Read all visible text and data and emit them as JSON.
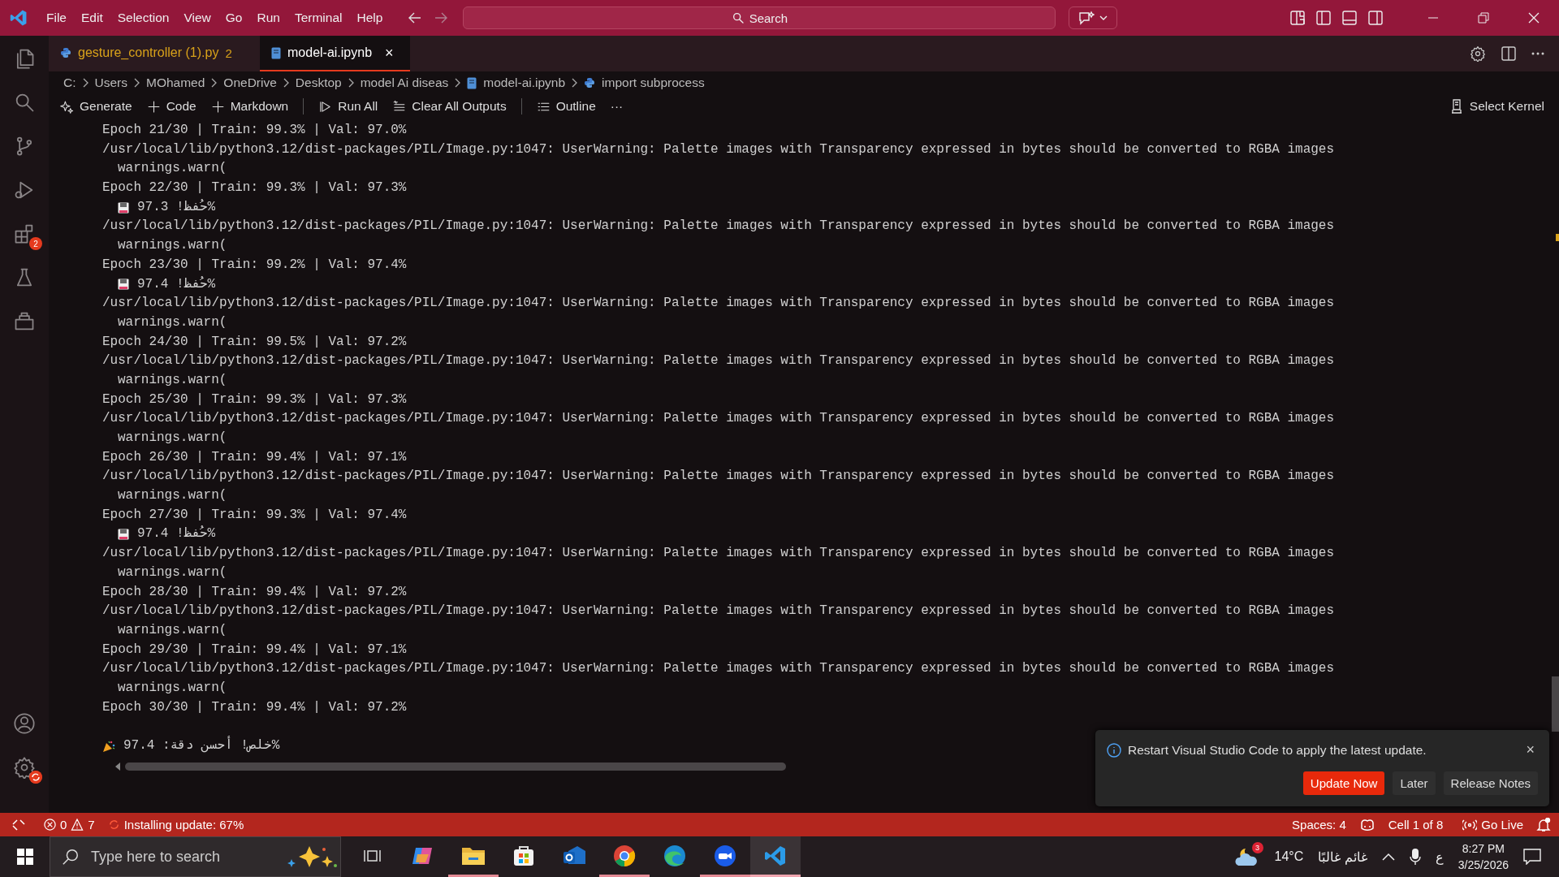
{
  "title_bar": {
    "menu": [
      "File",
      "Edit",
      "Selection",
      "View",
      "Go",
      "Run",
      "Terminal",
      "Help"
    ],
    "search": "Search"
  },
  "activity_bar": {
    "top": [
      {
        "kind": "files"
      },
      {
        "kind": "search"
      },
      {
        "kind": "source-control"
      },
      {
        "kind": "run-debug"
      },
      {
        "kind": "extensions",
        "badge": "2"
      },
      {
        "kind": "flask"
      },
      {
        "kind": "remote"
      }
    ],
    "bottom": [
      {
        "kind": "account"
      },
      {
        "kind": "settings"
      }
    ]
  },
  "tabs": [
    {
      "label": "gesture_controller (1).py",
      "badge": "2",
      "kind": "python",
      "selected": false
    },
    {
      "label": "model-ai.ipynb",
      "kind": "notebook",
      "selected": true,
      "close": "×"
    }
  ],
  "breadcrumb": [
    {
      "label": "C:"
    },
    {
      "label": "Users"
    },
    {
      "label": "MOhamed"
    },
    {
      "label": "OneDrive"
    },
    {
      "label": "Desktop"
    },
    {
      "label": "model Ai diseas"
    },
    {
      "label": "model-ai.ipynb",
      "kind": "notebook"
    },
    {
      "label": "import subprocess",
      "kind": "python"
    }
  ],
  "toolbar": {
    "groups": [
      [
        {
          "label": "Generate",
          "kind": "sparkle"
        },
        {
          "label": "Code",
          "kind": "plus"
        },
        {
          "label": "Markdown",
          "kind": "plus"
        }
      ],
      [
        {
          "label": "Run All",
          "kind": "run"
        },
        {
          "label": "Clear All Outputs",
          "kind": "clear"
        }
      ],
      [
        {
          "label": "Outline",
          "kind": "list"
        }
      ]
    ],
    "more": "···",
    "kernel": "Select Kernel"
  },
  "output": [
    {
      "kind": "text",
      "text": "Epoch 21/30 | Train: 99.3% | Val: 97.0%"
    },
    {
      "kind": "text",
      "text": "/usr/local/lib/python3.12/dist-packages/PIL/Image.py:1047: UserWarning: Palette images with Transparency expressed in bytes should be converted to RGBA images"
    },
    {
      "kind": "indent",
      "text": "warnings.warn("
    },
    {
      "kind": "text",
      "text": "Epoch 22/30 | Train: 99.3% | Val: 97.3%"
    },
    {
      "kind": "saved",
      "text": "حُفظ! 97.3%"
    },
    {
      "kind": "text",
      "text": "/usr/local/lib/python3.12/dist-packages/PIL/Image.py:1047: UserWarning: Palette images with Transparency expressed in bytes should be converted to RGBA images"
    },
    {
      "kind": "indent",
      "text": "warnings.warn("
    },
    {
      "kind": "text",
      "text": "Epoch 23/30 | Train: 99.2% | Val: 97.4%"
    },
    {
      "kind": "saved",
      "text": "حُفظ! 97.4%"
    },
    {
      "kind": "text",
      "text": "/usr/local/lib/python3.12/dist-packages/PIL/Image.py:1047: UserWarning: Palette images with Transparency expressed in bytes should be converted to RGBA images"
    },
    {
      "kind": "indent",
      "text": "warnings.warn("
    },
    {
      "kind": "text",
      "text": "Epoch 24/30 | Train: 99.5% | Val: 97.2%"
    },
    {
      "kind": "text",
      "text": "/usr/local/lib/python3.12/dist-packages/PIL/Image.py:1047: UserWarning: Palette images with Transparency expressed in bytes should be converted to RGBA images"
    },
    {
      "kind": "indent",
      "text": "warnings.warn("
    },
    {
      "kind": "text",
      "text": "Epoch 25/30 | Train: 99.3% | Val: 97.3%"
    },
    {
      "kind": "text",
      "text": "/usr/local/lib/python3.12/dist-packages/PIL/Image.py:1047: UserWarning: Palette images with Transparency expressed in bytes should be converted to RGBA images"
    },
    {
      "kind": "indent",
      "text": "warnings.warn("
    },
    {
      "kind": "text",
      "text": "Epoch 26/30 | Train: 99.4% | Val: 97.1%"
    },
    {
      "kind": "text",
      "text": "/usr/local/lib/python3.12/dist-packages/PIL/Image.py:1047: UserWarning: Palette images with Transparency expressed in bytes should be converted to RGBA images"
    },
    {
      "kind": "indent",
      "text": "warnings.warn("
    },
    {
      "kind": "text",
      "text": "Epoch 27/30 | Train: 99.3% | Val: 97.4%"
    },
    {
      "kind": "saved",
      "text": "حُفظ! 97.4%"
    },
    {
      "kind": "text",
      "text": "/usr/local/lib/python3.12/dist-packages/PIL/Image.py:1047: UserWarning: Palette images with Transparency expressed in bytes should be converted to RGBA images"
    },
    {
      "kind": "indent",
      "text": "warnings.warn("
    },
    {
      "kind": "text",
      "text": "Epoch 28/30 | Train: 99.4% | Val: 97.2%"
    },
    {
      "kind": "text",
      "text": "/usr/local/lib/python3.12/dist-packages/PIL/Image.py:1047: UserWarning: Palette images with Transparency expressed in bytes should be converted to RGBA images"
    },
    {
      "kind": "indent",
      "text": "warnings.warn("
    },
    {
      "kind": "text",
      "text": "Epoch 29/30 | Train: 99.4% | Val: 97.1%"
    },
    {
      "kind": "text",
      "text": "/usr/local/lib/python3.12/dist-packages/PIL/Image.py:1047: UserWarning: Palette images with Transparency expressed in bytes should be converted to RGBA images"
    },
    {
      "kind": "indent",
      "text": "warnings.warn("
    },
    {
      "kind": "text",
      "text": "Epoch 30/30 | Train: 99.4% | Val: 97.2%"
    },
    {
      "kind": "blank"
    },
    {
      "kind": "final",
      "text": "خلص! أحسن دقة: 97.4%"
    }
  ],
  "notification": {
    "message": "Restart Visual Studio Code to apply the latest update.",
    "close": "×",
    "buttons": [
      {
        "label": "Update Now",
        "primary": true
      },
      {
        "label": "Later",
        "primary": false
      },
      {
        "label": "Release Notes",
        "primary": false
      }
    ]
  },
  "status_bar": {
    "errors": "0",
    "warnings": "7",
    "progress": "Installing update: 67%",
    "spaces": "Spaces: 4",
    "cell": "Cell 1 of 8",
    "live": "Go Live"
  },
  "taskbar": {
    "search": "Type here to search",
    "apps": [
      {
        "kind": "task-view",
        "running": false,
        "selected": false
      },
      {
        "kind": "copilot",
        "running": false,
        "selected": false
      },
      {
        "kind": "folder",
        "running": true,
        "selected": false
      },
      {
        "kind": "store",
        "running": false,
        "selected": false
      },
      {
        "kind": "mail",
        "running": false,
        "selected": false
      },
      {
        "kind": "chrome",
        "running": true,
        "selected": false
      },
      {
        "kind": "edge",
        "running": false,
        "selected": false
      },
      {
        "kind": "zoom",
        "running": true,
        "selected": false
      },
      {
        "kind": "vscode",
        "running": true,
        "selected": true
      }
    ],
    "weather": {
      "badge": "3",
      "temp": "14°C",
      "condition": "غائم غالبًا"
    },
    "ime": "ع",
    "time": "8:27 PM",
    "date": "3/25/2026"
  }
}
